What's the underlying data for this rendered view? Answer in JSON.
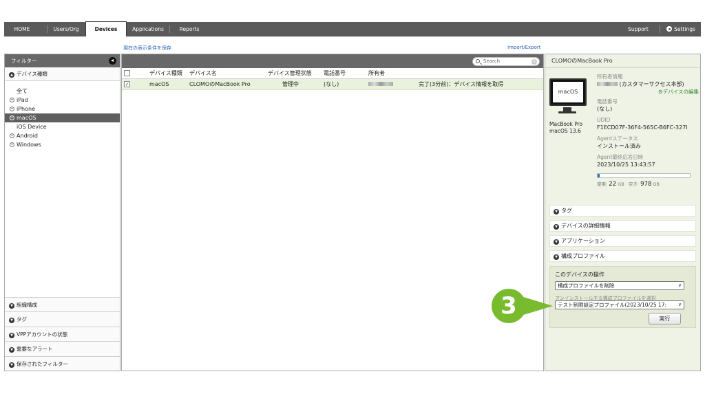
{
  "nav": {
    "items": [
      {
        "label": "HOME"
      },
      {
        "label": "Users/Org"
      },
      {
        "label": "Devices"
      },
      {
        "label": "Applications"
      },
      {
        "label": "Reports"
      }
    ],
    "support": "Support",
    "settings": "Settings"
  },
  "links": {
    "save_filter": "現在の表示条件を保存",
    "import_export": "Import/Export"
  },
  "filter": {
    "header": "フィルター",
    "device_type_section": "デバイス種類",
    "device_types": [
      {
        "label": "全て"
      },
      {
        "label": "iPad"
      },
      {
        "label": "iPhone"
      },
      {
        "label": "macOS"
      },
      {
        "label": "iOS Device"
      },
      {
        "label": "Android"
      },
      {
        "label": "Windows"
      }
    ],
    "bottom_sections": [
      {
        "label": "組織構成"
      },
      {
        "label": "タグ"
      },
      {
        "label": "VPPアカウントの状態"
      },
      {
        "label": "重要なアラート"
      },
      {
        "label": "保存されたフィルター"
      }
    ]
  },
  "list": {
    "search_placeholder": "Search",
    "columns": [
      "デバイス種類",
      "デバイス名",
      "デバイス管理状態",
      "電話番号",
      "所有者"
    ],
    "rows": [
      {
        "checked": true,
        "type": "macOS",
        "name": "CLOMOのMacBook Pro",
        "state": "管理中",
        "phone": "(なし)",
        "owner": "",
        "status": "完了(3分前)：デバイス情報を取得"
      }
    ]
  },
  "detail": {
    "title": "CLOMOのMacBook Pro",
    "icon_label": "macOS",
    "model": "MacBook Pro",
    "os": "macOS 13.6",
    "owner_label": "所有者情報",
    "owner_value": "(カスタマーサクセス本部)",
    "edit_link": "デバイスの編集",
    "phone_label": "電話番号",
    "phone_value": "(なし)",
    "udid_label": "UDID",
    "udid_value": "F1ECD07F-36F4-565C-B6FC-327I",
    "agent_status_label": "Agentステータス",
    "agent_status_value": "インストール済み",
    "agent_last_label": "Agent最終応答日時",
    "agent_last_value": "2023/10/25 13:43:57",
    "storage": {
      "used_label": "使用:",
      "used": "22",
      "free_label": "空き:",
      "free": "978",
      "unit": "GB",
      "used_fraction": 0.022
    },
    "accordions": [
      {
        "label": "タグ"
      },
      {
        "label": "デバイスの詳細情報"
      },
      {
        "label": "アプリケーション"
      },
      {
        "label": "構成プロファイル"
      }
    ],
    "operations": {
      "title": "このデバイスの操作",
      "action_select": "構成プロファイルを削除",
      "profile_label": "アンインストールする構成プロファイルを選択",
      "profile_select": "テスト制限設定プロファイル(2023/10/25 17:",
      "execute": "実行"
    }
  },
  "step_badge": "3",
  "colors": {
    "nav_bg": "#5a5a5a",
    "accent_green": "#79bb2f",
    "link_blue": "#2a62b8",
    "selected_row": "#e9f2dc",
    "detail_bg": "#eff3e6"
  }
}
